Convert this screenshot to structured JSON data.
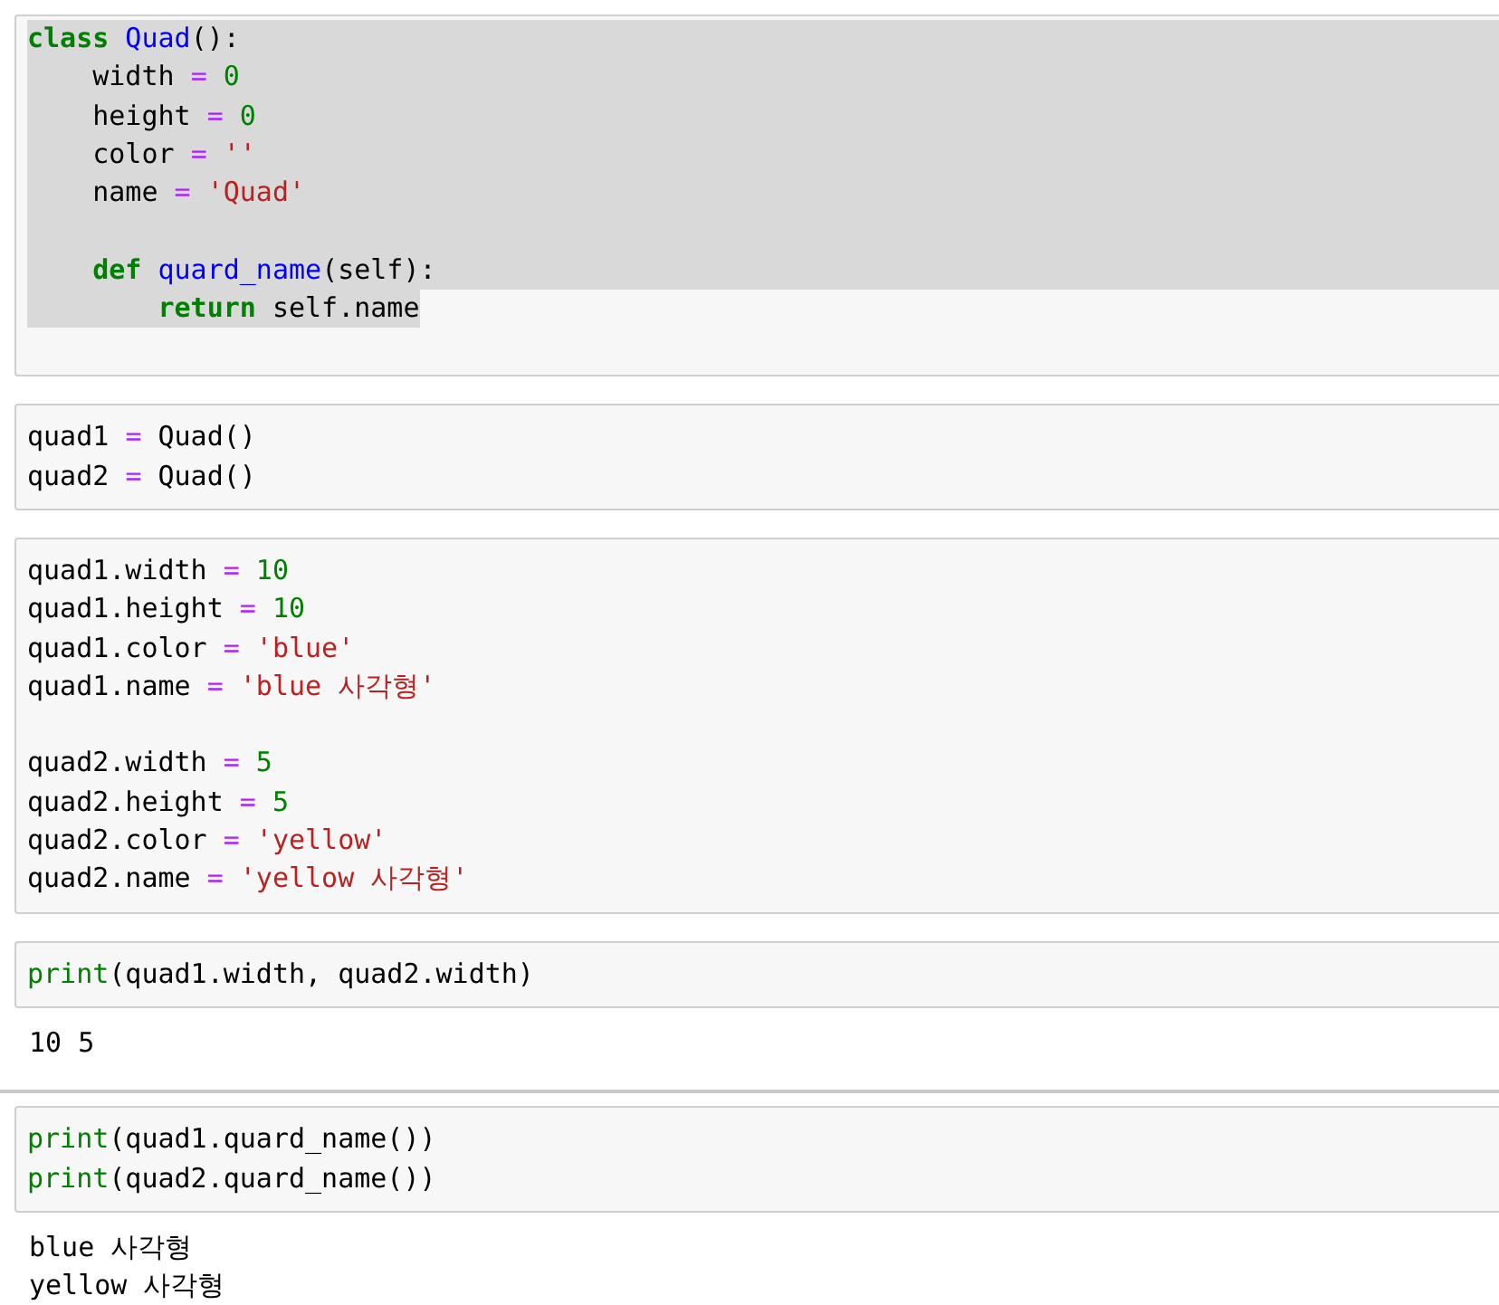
{
  "cells": [
    {
      "lines": [
        {
          "kind": "code",
          "selected": true,
          "tokens": [
            {
              "kind": "keyword",
              "text": "class"
            },
            {
              "kind": "defname",
              "text": " Quad"
            },
            {
              "kind": "plain",
              "text": "():"
            }
          ]
        },
        {
          "kind": "code",
          "selected": true,
          "tokens": [
            {
              "kind": "plain",
              "text": "    width "
            },
            {
              "kind": "operator",
              "text": "="
            },
            {
              "kind": "number",
              "text": " 0"
            }
          ]
        },
        {
          "kind": "code",
          "selected": true,
          "tokens": [
            {
              "kind": "plain",
              "text": "    height "
            },
            {
              "kind": "operator",
              "text": "="
            },
            {
              "kind": "number",
              "text": " 0"
            }
          ]
        },
        {
          "kind": "code",
          "selected": true,
          "tokens": [
            {
              "kind": "plain",
              "text": "    color "
            },
            {
              "kind": "operator",
              "text": "="
            },
            {
              "kind": "string",
              "text": " ''"
            }
          ]
        },
        {
          "kind": "code",
          "selected": true,
          "tokens": [
            {
              "kind": "plain",
              "text": "    name "
            },
            {
              "kind": "operator",
              "text": "="
            },
            {
              "kind": "string",
              "text": " 'Quad'"
            }
          ]
        },
        {
          "kind": "blank",
          "selected": true
        },
        {
          "kind": "code",
          "selected": true,
          "tokens": [
            {
              "kind": "keyword",
              "text": "    def"
            },
            {
              "kind": "defname",
              "text": " quard_name"
            },
            {
              "kind": "plain",
              "text": "(self):"
            }
          ]
        },
        {
          "kind": "code",
          "selected": true,
          "tokens": [
            {
              "kind": "keyword",
              "text": "        return"
            },
            {
              "kind": "plain",
              "text": " self.name"
            }
          ]
        }
      ]
    },
    {
      "lines": [
        {
          "kind": "code",
          "selected": false,
          "tokens": [
            {
              "kind": "plain",
              "text": "quad1 "
            },
            {
              "kind": "operator",
              "text": "="
            },
            {
              "kind": "plain",
              "text": " Quad()"
            }
          ]
        },
        {
          "kind": "code",
          "selected": false,
          "tokens": [
            {
              "kind": "plain",
              "text": "quad2 "
            },
            {
              "kind": "operator",
              "text": "="
            },
            {
              "kind": "plain",
              "text": " Quad()"
            }
          ]
        }
      ]
    },
    {
      "lines": [
        {
          "kind": "code",
          "selected": false,
          "tokens": [
            {
              "kind": "plain",
              "text": "quad1.width "
            },
            {
              "kind": "operator",
              "text": "="
            },
            {
              "kind": "number",
              "text": " 10"
            }
          ]
        },
        {
          "kind": "code",
          "selected": false,
          "tokens": [
            {
              "kind": "plain",
              "text": "quad1.height "
            },
            {
              "kind": "operator",
              "text": "="
            },
            {
              "kind": "number",
              "text": " 10"
            }
          ]
        },
        {
          "kind": "code",
          "selected": false,
          "tokens": [
            {
              "kind": "plain",
              "text": "quad1.color "
            },
            {
              "kind": "operator",
              "text": "="
            },
            {
              "kind": "string",
              "text": " 'blue'"
            }
          ]
        },
        {
          "kind": "code",
          "selected": false,
          "tokens": [
            {
              "kind": "plain",
              "text": "quad1.name "
            },
            {
              "kind": "operator",
              "text": "="
            },
            {
              "kind": "string",
              "text": " 'blue 사각형'"
            }
          ]
        },
        {
          "kind": "blank",
          "selected": false
        },
        {
          "kind": "code",
          "selected": false,
          "tokens": [
            {
              "kind": "plain",
              "text": "quad2.width "
            },
            {
              "kind": "operator",
              "text": "="
            },
            {
              "kind": "number",
              "text": " 5"
            }
          ]
        },
        {
          "kind": "code",
          "selected": false,
          "tokens": [
            {
              "kind": "plain",
              "text": "quad2.height "
            },
            {
              "kind": "operator",
              "text": "="
            },
            {
              "kind": "number",
              "text": " 5"
            }
          ]
        },
        {
          "kind": "code",
          "selected": false,
          "tokens": [
            {
              "kind": "plain",
              "text": "quad2.color "
            },
            {
              "kind": "operator",
              "text": "="
            },
            {
              "kind": "string",
              "text": " 'yellow'"
            }
          ]
        },
        {
          "kind": "code",
          "selected": false,
          "tokens": [
            {
              "kind": "plain",
              "text": "quad2.name "
            },
            {
              "kind": "operator",
              "text": "="
            },
            {
              "kind": "string",
              "text": " 'yellow 사각형'"
            }
          ]
        }
      ]
    },
    {
      "lines": [
        {
          "kind": "code",
          "selected": false,
          "tokens": [
            {
              "kind": "builtin",
              "text": "print"
            },
            {
              "kind": "plain",
              "text": "(quad1.width, quad2.width)"
            }
          ]
        }
      ],
      "output": [
        "10 5"
      ]
    },
    {
      "lines": [
        {
          "kind": "code",
          "selected": false,
          "tokens": [
            {
              "kind": "builtin",
              "text": "print"
            },
            {
              "kind": "plain",
              "text": "(quad1.quard_name())"
            }
          ]
        },
        {
          "kind": "code",
          "selected": false,
          "tokens": [
            {
              "kind": "builtin",
              "text": "print"
            },
            {
              "kind": "plain",
              "text": "(quad2.quard_name())"
            }
          ]
        }
      ],
      "output": [
        "blue 사각형",
        "yellow 사각형"
      ]
    }
  ]
}
